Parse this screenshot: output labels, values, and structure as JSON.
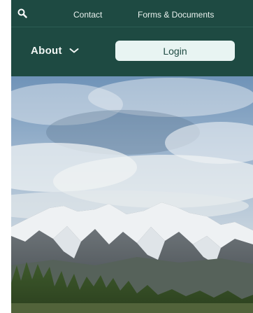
{
  "topbar": {
    "search_icon": "search-icon",
    "contact_label": "Contact",
    "forms_label": "Forms & Documents"
  },
  "navbar": {
    "about_label": "About",
    "about_icon": "chevron-down-icon",
    "login_label": "Login"
  },
  "hero": {
    "image": "mountain-landscape"
  },
  "colors": {
    "header_bg": "#1e4a42",
    "login_bg": "#e8f4f2",
    "header_text": "#f1f6f4"
  }
}
